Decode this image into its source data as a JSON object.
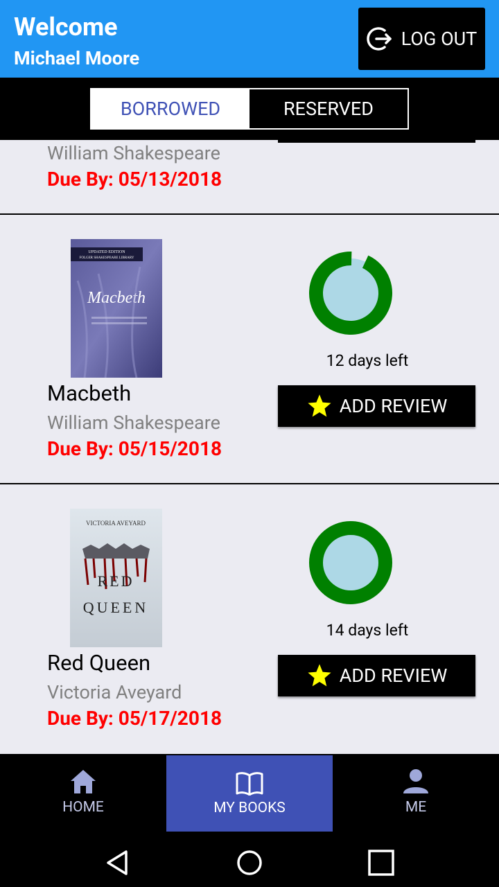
{
  "header": {
    "welcome": "Welcome",
    "username": "Michael Moore",
    "logout_label": "LOG OUT"
  },
  "tabs": [
    {
      "label": "BORROWED",
      "active": true
    },
    {
      "label": "RESERVED",
      "active": false
    }
  ],
  "books": [
    {
      "title": "",
      "author": "William Shakespeare",
      "due": "Due By: 05/13/2018"
    },
    {
      "title": "Macbeth",
      "author": "William Shakespeare",
      "due": "Due By: 05/15/2018",
      "days_left": "12 days left",
      "progress": 0.07,
      "review_label": "ADD REVIEW",
      "cover_text": [
        "UPDATED EDITION",
        "FOLGER SHAKESPEARE LIBRARY",
        "Macbeth"
      ]
    },
    {
      "title": "Red Queen",
      "author": "Victoria Aveyard",
      "due": "Due By: 05/17/2018",
      "days_left": "14 days left",
      "progress": 0.0,
      "review_label": "ADD REVIEW",
      "cover_text": [
        "VICTORIA AVEYARD",
        "RED",
        "QUEEN"
      ]
    }
  ],
  "bottom_nav": [
    {
      "label": "HOME",
      "icon": "home-icon",
      "active": false
    },
    {
      "label": "MY BOOKS",
      "icon": "book-icon",
      "active": true
    },
    {
      "label": "ME",
      "icon": "person-icon",
      "active": false
    }
  ],
  "colors": {
    "header": "#2196f3",
    "accent": "#3f51b5",
    "due": "#ff0000",
    "ring": "#008000",
    "ring_fill": "#add8e6",
    "star": "#ffff00"
  }
}
